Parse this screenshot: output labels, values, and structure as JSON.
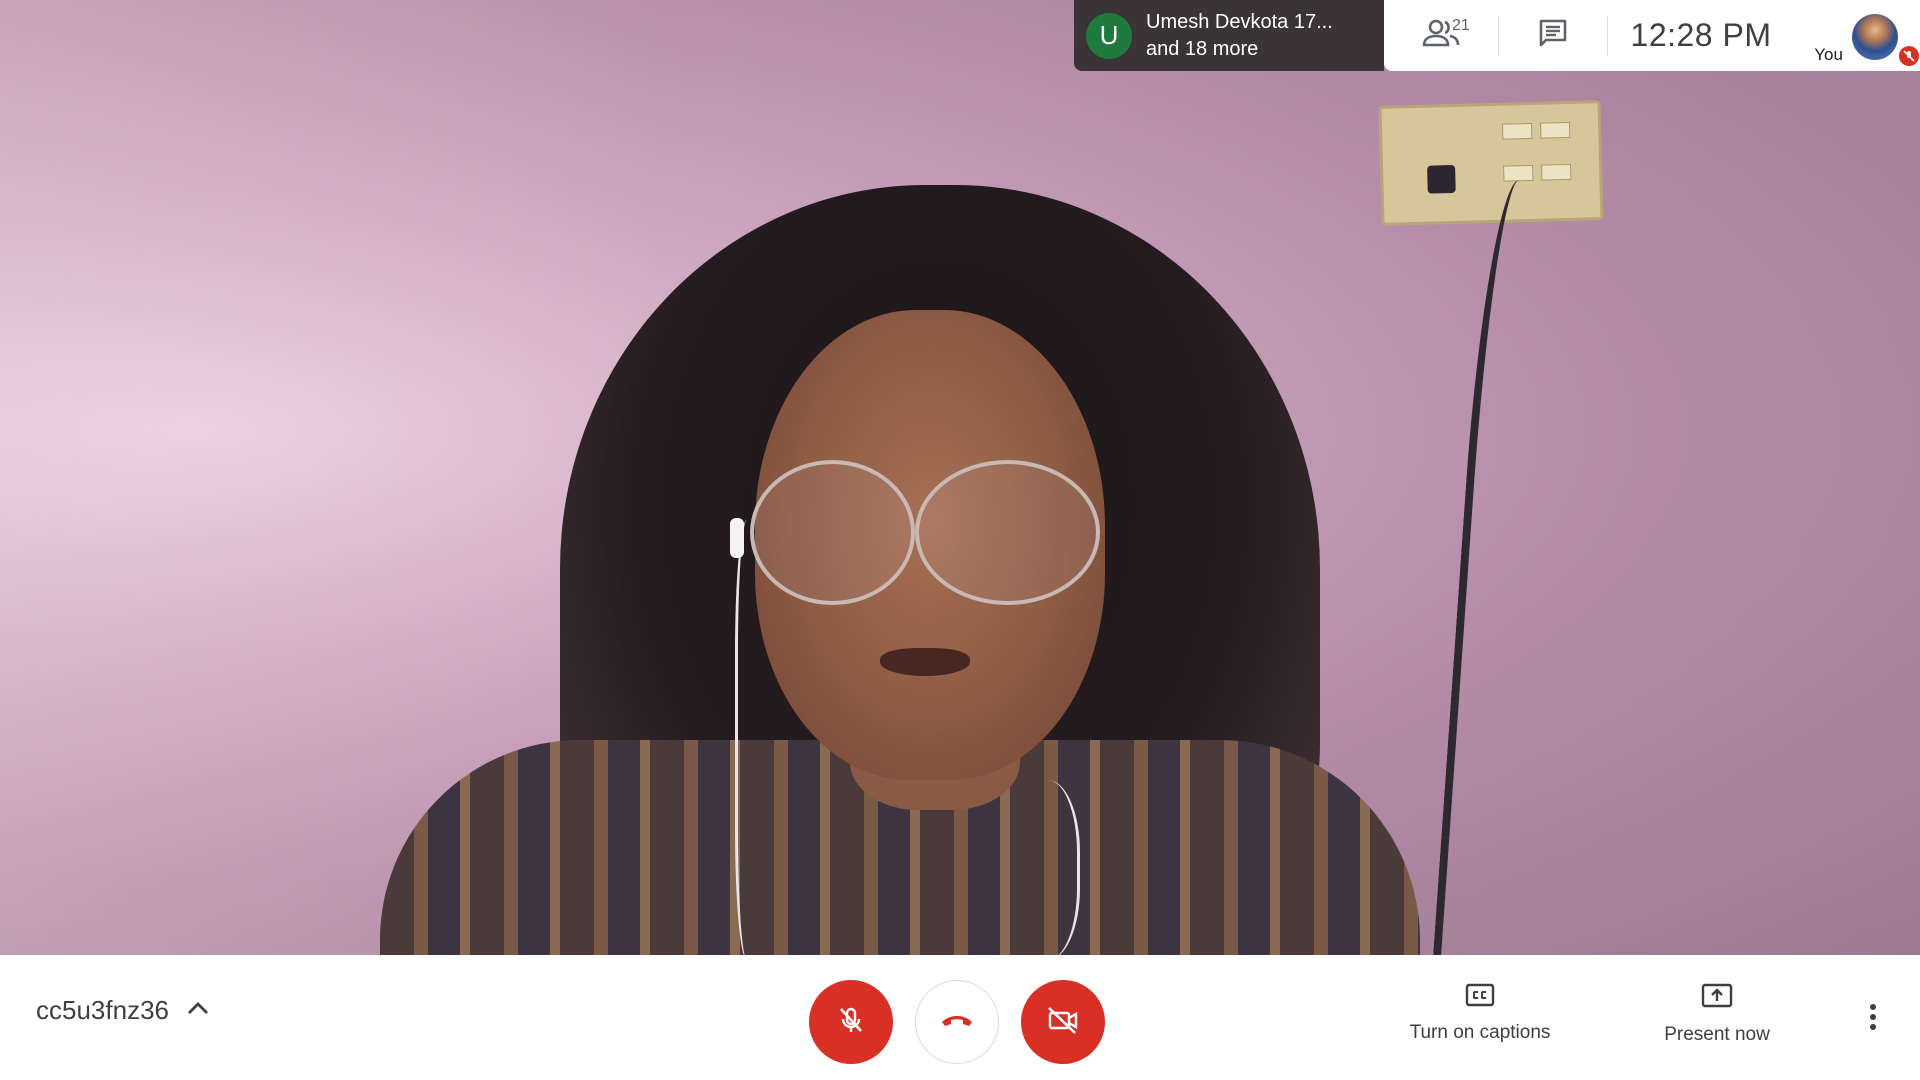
{
  "participants": {
    "avatar_initial": "U",
    "name_line": "Umesh Devkota 17...",
    "more_line": "and 18 more"
  },
  "top_bar": {
    "people_count": "21",
    "people_icon": "people-icon",
    "chat_icon": "chat-icon",
    "clock": "12:28 PM",
    "self_label": "You",
    "self_muted_icon": "mic-off-icon"
  },
  "bottom_bar": {
    "meeting_code": "cc5u3fnz36",
    "chevron_icon": "chevron-up-icon",
    "mic_icon": "mic-off-icon",
    "hangup_icon": "phone-hangup-icon",
    "camera_icon": "camera-off-icon",
    "captions_icon": "closed-captions-icon",
    "captions_label": "Turn on captions",
    "present_icon": "present-screen-icon",
    "present_label": "Present now",
    "more_icon": "more-vert-icon"
  },
  "colors": {
    "danger_red": "#d93025",
    "avatar_green": "#1e7b3d",
    "text_dark": "#3c4043"
  }
}
